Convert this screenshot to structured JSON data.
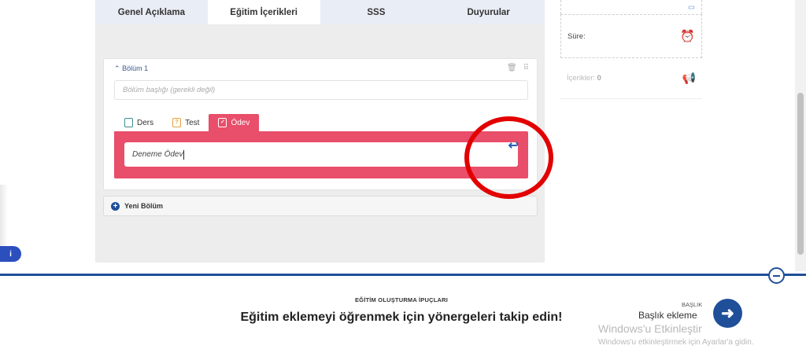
{
  "tabs": [
    "Genel Açıklama",
    "Eğitim İçerikleri",
    "SSS",
    "Duyurular"
  ],
  "section": {
    "label": "Bölüm 1",
    "title_placeholder": "Bölüm başlığı (gerekli değil)",
    "content_types": [
      "Ders",
      "Test",
      "Ödev"
    ],
    "active_type": "Ödev",
    "assignment_value": "Deneme Ödev"
  },
  "new_section_label": "Yeni Bölüm",
  "sidebar": {
    "duration_label": "Süre:",
    "contents_label": "İçerikler:",
    "contents_count": "0"
  },
  "tips": {
    "heading": "EĞİTİM OLUŞTURMA İPUÇLARI",
    "text": "Eğitim eklemeyi öğrenmek için yönergeleri takip edin!",
    "next_label": "BAŞLIK",
    "next_title": "Başlık ekleme"
  },
  "watermark": {
    "line1": "Windows'u Etkinleştir",
    "line2": "Windows'u etkinleştirmek için Ayarlar'a gidin."
  },
  "colors": {
    "accent_pink": "#e94e6a",
    "primary_blue": "#1f4f99",
    "annotation_red": "#e20000"
  }
}
